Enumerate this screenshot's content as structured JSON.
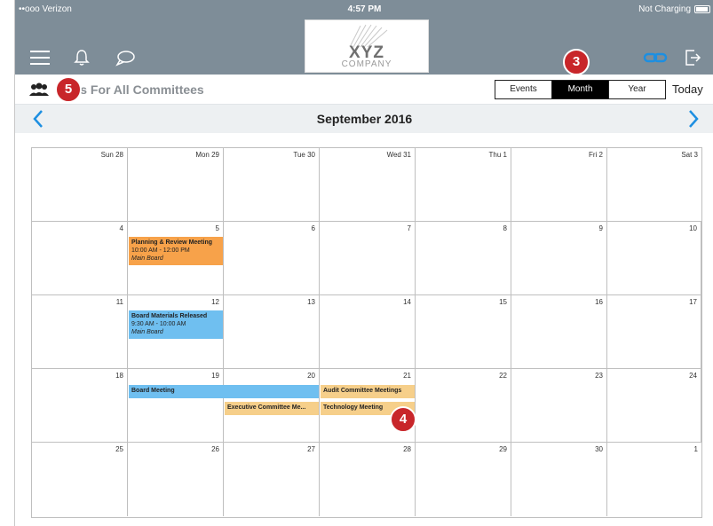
{
  "status_bar": {
    "carrier": "••ooo Verizon",
    "time": "4:57 PM",
    "battery_text": "Not Charging"
  },
  "header": {
    "logo_text": "XYZ",
    "logo_subtext": "COMPANY"
  },
  "titlebar": {
    "title": "nts For All Committees",
    "segments": [
      "Events",
      "Month",
      "Year"
    ],
    "active_segment": "Month",
    "today_label": "Today"
  },
  "calendar": {
    "month_title": "September 2016",
    "weeks": [
      [
        "Sun 28",
        "Mon 29",
        "Tue 30",
        "Wed 31",
        "Thu 1",
        "Fri 2",
        "Sat 3"
      ],
      [
        "4",
        "5",
        "6",
        "7",
        "8",
        "9",
        "10"
      ],
      [
        "11",
        "12",
        "13",
        "14",
        "15",
        "16",
        "17"
      ],
      [
        "18",
        "19",
        "20",
        "21",
        "22",
        "23",
        "24"
      ],
      [
        "25",
        "26",
        "27",
        "28",
        "29",
        "30",
        "1"
      ]
    ],
    "events": [
      {
        "title": "Planning & Review Meeting",
        "time": "10:00 AM - 12:00 PM",
        "location": "Main Board",
        "color": "#f7a24a"
      },
      {
        "title": "Board Materials Released",
        "time": "9:30 AM - 10:00 AM",
        "location": "Main Board",
        "color": "#6fbff0"
      },
      {
        "title": "Board Meeting",
        "color": "#6fbff0"
      },
      {
        "title": "Audit Committee Meetings",
        "color": "#f6cf8a"
      },
      {
        "title": "Executive Committee Me...",
        "color": "#f6cf8a"
      },
      {
        "title": "Technology Meeting",
        "color": "#f6cf8a"
      }
    ]
  },
  "annotations": {
    "badge_3": "3",
    "badge_4": "4",
    "badge_5": "5"
  },
  "colors": {
    "header_bg": "#7e8d98",
    "accent_blue": "#1d8fe1",
    "badge_red": "#c8262a"
  }
}
